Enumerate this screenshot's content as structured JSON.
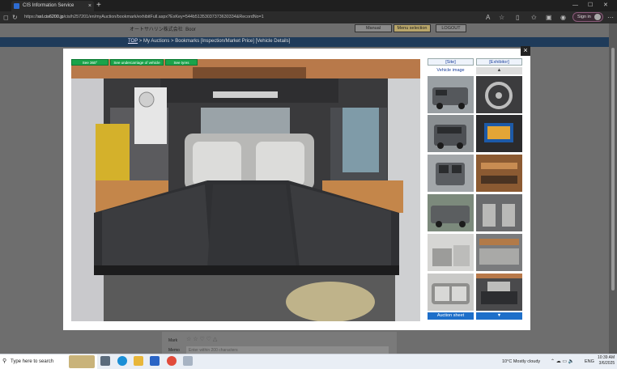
{
  "browser": {
    "tab_title": "CIS Information Service",
    "tab_close": "×",
    "new_tab": "+",
    "url_prefix": "https://",
    "url_host": "ssl.cis6200.jp",
    "url_path": "/cis/h257201/en/myAuction/bookmark/exhibitFull.aspx?ExKey=544b51353037373630334&RecordNo=1",
    "sign_in": "Sign in",
    "win_min": "—",
    "win_max": "☐",
    "win_close": "✕"
  },
  "site": {
    "brand": "オートサハリン株式会社",
    "brand_suffix": "Boor",
    "manual_label": "Manual",
    "menu_selection_label": "Menu selection",
    "logout_label": "LOGOUT",
    "breadcrumb": {
      "top": "TOP",
      "my_auctions": "My Auctions",
      "bookmarks": "Bookmarks [Inspection/Market Price]",
      "details": "[Vehicle Details]",
      "sep": ">"
    },
    "mark_label": "Mark",
    "memo_label": "Memo",
    "memo_placeholder": "Enter within 200 characters"
  },
  "modal": {
    "close": "×",
    "buttons": {
      "see360": "See 360°",
      "undercarriage": "See undercarriage of vehicle",
      "tyres": "See tyres"
    },
    "tabs": {
      "site": "[Site]",
      "exhibitor": "[Exhibitor]"
    },
    "vehicle_image_label": "Vehicle image",
    "up_arrow": "▲",
    "auction_sheet": "Auction sheet",
    "down_arrow": "▼"
  },
  "taskbar": {
    "search_placeholder": "Type here to search",
    "temperature": "10°C",
    "weather": "Mostly cloudy",
    "lang": "ENG",
    "time": "10:39 AM",
    "date": "3/6/2025"
  },
  "colors": {
    "accent_green": "#1aa34a",
    "accent_blue": "#1e6fc9",
    "nav_blue": "#1f3b5a"
  }
}
